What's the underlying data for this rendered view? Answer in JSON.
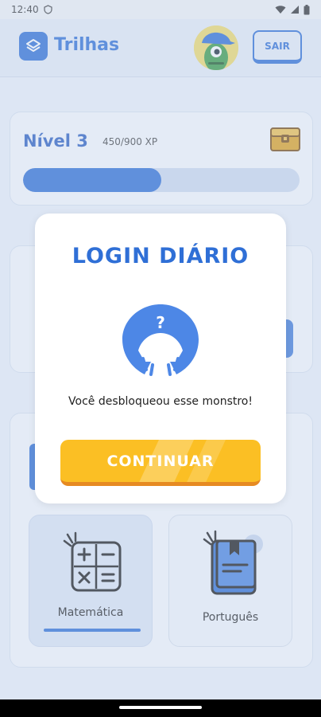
{
  "status_bar": {
    "time": "12:40"
  },
  "header": {
    "title": "Trilhas",
    "logout_label": "SAIR"
  },
  "level": {
    "title": "Nível 3",
    "xp": "450/900 XP",
    "progress": 0.5
  },
  "subjects": [
    {
      "label": "Matemática",
      "active": true
    },
    {
      "label": "Português",
      "active": false
    }
  ],
  "modal": {
    "title": "LOGIN DIÁRIO",
    "message": "Você desbloqueou esse monstro!",
    "button_label": "CONTINUAR"
  },
  "colors": {
    "primary": "#2f6fd6",
    "button": "#fbbf24",
    "button_shadow": "#e68a22"
  },
  "icons": [
    "shield-icon",
    "wifi-icon",
    "signal-icon",
    "battery-icon",
    "layers-icon",
    "monster-avatar-icon",
    "treasure-chest-icon",
    "locked-monster-icon",
    "calculator-icon",
    "book-icon"
  ]
}
